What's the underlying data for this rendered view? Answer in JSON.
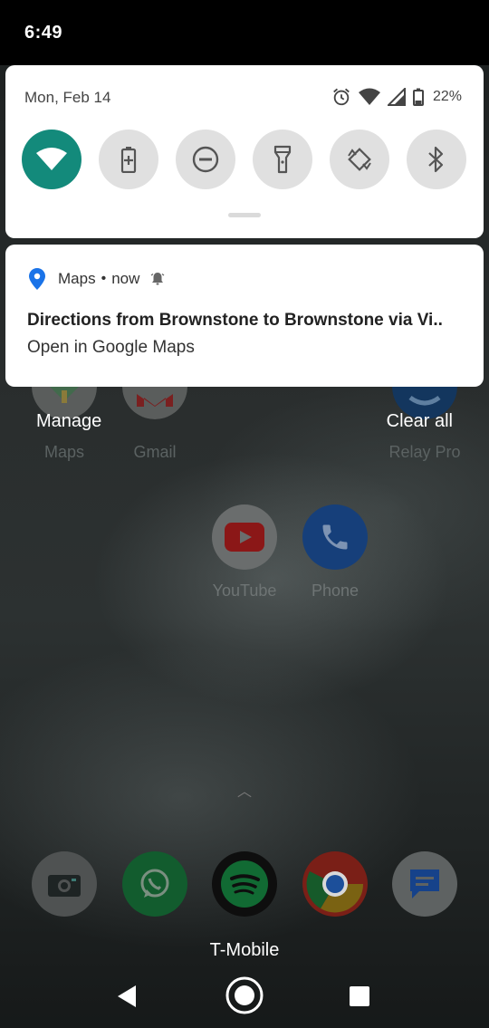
{
  "status_bar": {
    "time": "6:49"
  },
  "quick_settings": {
    "date": "Mon, Feb 14",
    "battery_percent": "22%",
    "tiles": [
      {
        "name": "wifi",
        "active": true
      },
      {
        "name": "battery-saver",
        "active": false
      },
      {
        "name": "do-not-disturb",
        "active": false
      },
      {
        "name": "flashlight",
        "active": false
      },
      {
        "name": "auto-rotate",
        "active": false
      },
      {
        "name": "bluetooth",
        "active": false
      }
    ]
  },
  "notification": {
    "app_name": "Maps",
    "separator": "•",
    "time": "now",
    "title": "Directions from Brownstone to Brownstone via Vi..",
    "text": "Open in Google Maps"
  },
  "notification_actions": {
    "manage": "Manage",
    "clear_all": "Clear all"
  },
  "home_screen": {
    "top_row_labels": [
      "Maps",
      "Gmail",
      "Relay Pro"
    ],
    "middle_apps": [
      {
        "label": "YouTube"
      },
      {
        "label": "Phone"
      }
    ],
    "dock_apps": [
      "camera",
      "whatsapp",
      "spotify",
      "chrome",
      "messages"
    ]
  },
  "carrier": "T-Mobile",
  "colors": {
    "accent_teal": "#138a7b",
    "maps_pin_blue": "#1a73e8"
  }
}
